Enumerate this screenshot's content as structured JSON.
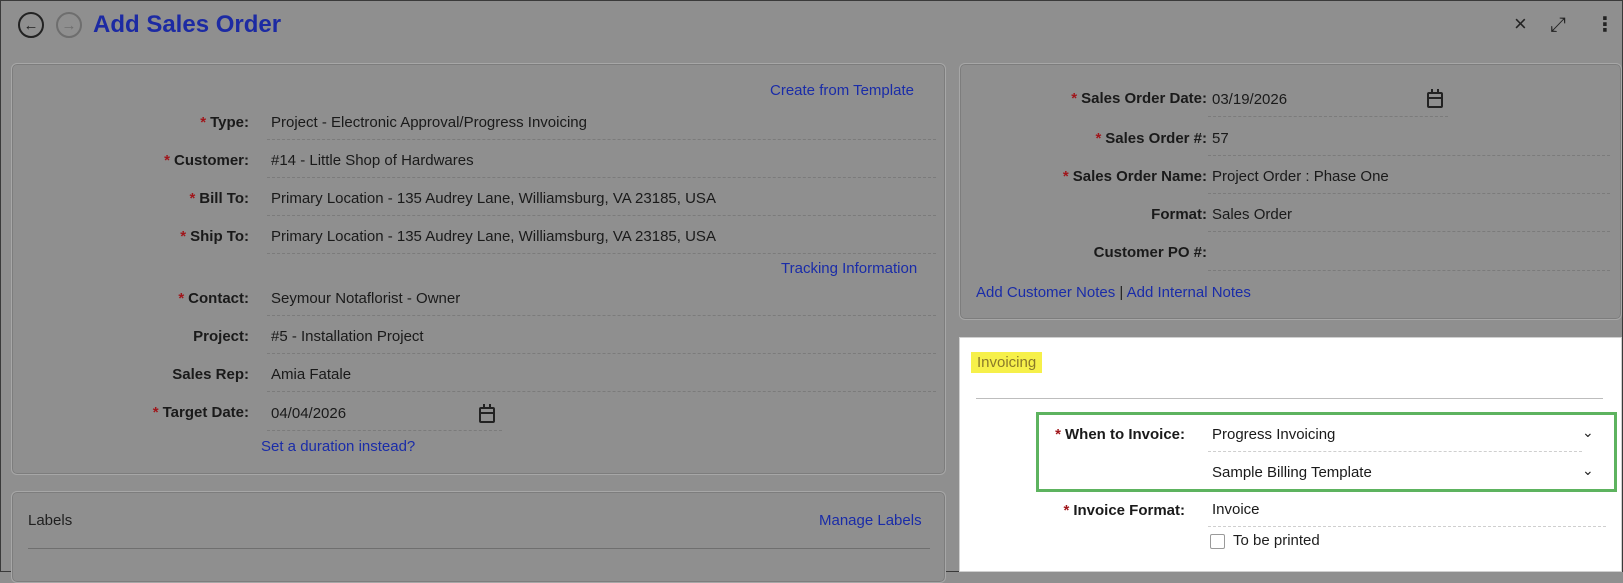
{
  "header": {
    "title": "Add Sales Order",
    "back_icon": "arrow-left-icon",
    "forward_icon": "arrow-right-icon"
  },
  "left_panel": {
    "create_template_link": "Create from Template",
    "fields": {
      "type": {
        "label": "Type:",
        "value": "Project - Electronic Approval/Progress Invoicing",
        "required": true
      },
      "customer": {
        "label": "Customer:",
        "value": "#14 - Little Shop of Hardwares",
        "required": true
      },
      "bill_to": {
        "label": "Bill To:",
        "value": "Primary Location - 135 Audrey Lane, Williamsburg, VA 23185, USA",
        "required": true
      },
      "ship_to": {
        "label": "Ship To:",
        "value": "Primary Location - 135 Audrey Lane, Williamsburg, VA 23185, USA",
        "required": true
      },
      "contact": {
        "label": "Contact:",
        "value": "Seymour Notaflorist - Owner",
        "required": true
      },
      "project": {
        "label": "Project:",
        "value": "#5 - Installation Project",
        "required": false
      },
      "sales_rep": {
        "label": "Sales Rep:",
        "value": "Amia Fatale",
        "required": false
      },
      "target_date": {
        "label": "Target Date:",
        "value": "04/04/2026",
        "required": true
      }
    },
    "tracking_link": "Tracking Information",
    "duration_link": "Set a duration instead?"
  },
  "labels_panel": {
    "title": "Labels",
    "manage_link": "Manage Labels"
  },
  "right_panel": {
    "fields": {
      "so_date": {
        "label": "Sales Order Date:",
        "value": "03/19/2026",
        "required": true
      },
      "so_number": {
        "label": "Sales Order #:",
        "value": "57",
        "required": true
      },
      "so_name": {
        "label": "Sales Order Name:",
        "value": "Project Order : Phase One",
        "required": true
      },
      "format": {
        "label": "Format:",
        "value": "Sales Order",
        "required": false
      },
      "customer_po": {
        "label": "Customer PO #:",
        "value": "",
        "required": false
      }
    },
    "customer_notes_link": "Add Customer Notes",
    "notes_separator": "|",
    "internal_notes_link": "Add Internal Notes"
  },
  "invoicing": {
    "title": "Invoicing",
    "when_to_invoice": {
      "label": "When to Invoice:",
      "value": "Progress Invoicing",
      "required": true
    },
    "billing_template": {
      "value": "Sample Billing Template"
    },
    "invoice_format": {
      "label": "Invoice Format:",
      "value": "Invoice",
      "required": true
    },
    "to_be_printed": {
      "label": "To be printed",
      "checked": false
    }
  },
  "colors": {
    "link": "#1a2ca8",
    "required": "#a0161b",
    "highlight": "#f6f04a",
    "focus_box": "#5db35f",
    "overlay": "#8f8f8f"
  }
}
